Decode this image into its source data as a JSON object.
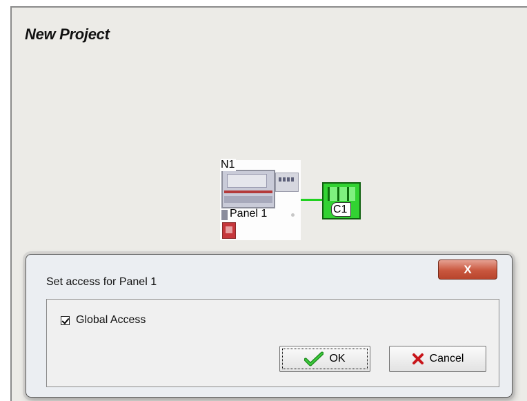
{
  "canvas": {
    "title": "New Project"
  },
  "diagram": {
    "panel_node": {
      "id_label": "N1",
      "name": "Panel 1"
    },
    "controller_node": {
      "label": "C1"
    },
    "link_color": "#20d120"
  },
  "dialog": {
    "title": "Set access for Panel 1",
    "close_glyph": "X",
    "checkbox": {
      "label": "Global Access",
      "checked": true
    },
    "ok_label": "OK",
    "cancel_label": "Cancel",
    "icons": {
      "ok": "green-check-icon",
      "cancel": "red-x-icon",
      "close": "close-icon"
    }
  }
}
